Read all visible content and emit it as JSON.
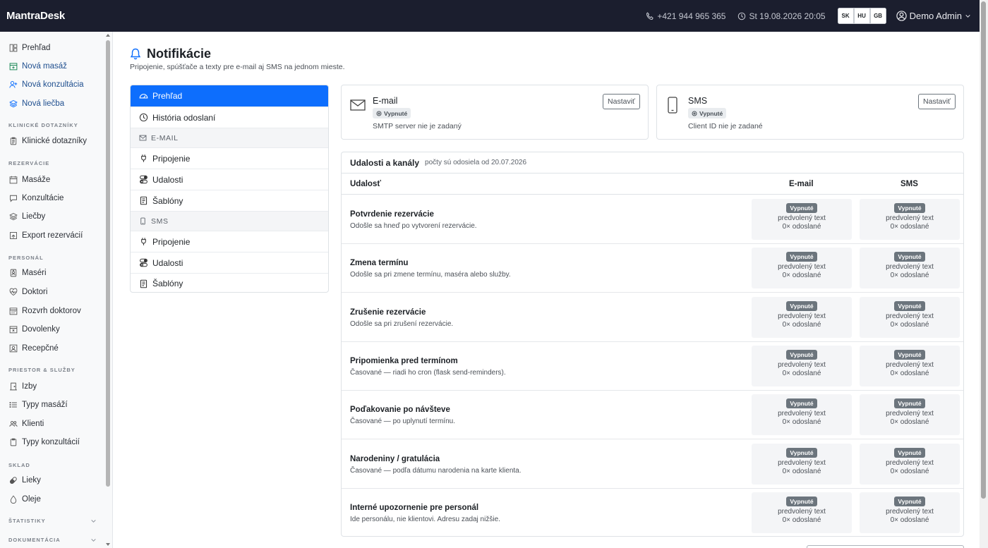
{
  "app": {
    "brand": "MantraDesk"
  },
  "topbar": {
    "phone": "+421 944 965 365",
    "datetime": "St 19.08.2026 20:05",
    "languages": [
      "SK",
      "HU",
      "GB"
    ],
    "user": "Demo Admin"
  },
  "sidebar": {
    "top_items": [
      {
        "label": "Prehľad",
        "icon": "dashboard-icon"
      },
      {
        "label": "Nová masáž",
        "icon": "calendar-plus-icon"
      },
      {
        "label": "Nová konzultácia",
        "icon": "person-plus-icon"
      },
      {
        "label": "Nová liečba",
        "icon": "layers-icon"
      }
    ],
    "sections": [
      {
        "title": "KLINICKÉ DOTAZNÍKY",
        "items": [
          {
            "label": "Klinické dotazníky",
            "icon": "clipboard-icon"
          }
        ]
      },
      {
        "title": "REZERVÁCIE",
        "items": [
          {
            "label": "Masáže",
            "icon": "calendar-icon"
          },
          {
            "label": "Konzultácie",
            "icon": "chat-icon"
          },
          {
            "label": "Liečby",
            "icon": "layers-icon"
          },
          {
            "label": "Export rezervácií",
            "icon": "export-icon"
          }
        ]
      },
      {
        "title": "PERSONÁL",
        "items": [
          {
            "label": "Maséri",
            "icon": "person-badge-icon"
          },
          {
            "label": "Doktori",
            "icon": "heart-pulse-icon"
          },
          {
            "label": "Rozvrh doktorov",
            "icon": "calendar-week-icon"
          },
          {
            "label": "Dovolenky",
            "icon": "calendar-x-icon"
          },
          {
            "label": "Recepčné",
            "icon": "person-square-icon"
          }
        ]
      },
      {
        "title": "PRIESTOR & SLUŽBY",
        "items": [
          {
            "label": "Izby",
            "icon": "door-icon"
          },
          {
            "label": "Typy masáží",
            "icon": "list-icon"
          },
          {
            "label": "Klienti",
            "icon": "people-icon"
          },
          {
            "label": "Typy konzultácií",
            "icon": "clipboard-icon"
          }
        ]
      },
      {
        "title": "SKLAD",
        "items": [
          {
            "label": "Lieky",
            "icon": "capsule-icon"
          },
          {
            "label": "Oleje",
            "icon": "droplet-icon"
          }
        ]
      }
    ],
    "collapsed": [
      "ŠTATISTIKY",
      "DOKUMENTÁCIA"
    ]
  },
  "page": {
    "title": "Notifikácie",
    "subtitle": "Pripojenie, spúšťače a texty pre e-mail aj SMS na jednom mieste."
  },
  "menu": {
    "items": [
      {
        "label": "Prehľad",
        "icon": "speedometer-icon",
        "kind": "active"
      },
      {
        "label": "História odoslaní",
        "icon": "clock-history-icon",
        "kind": "item"
      },
      {
        "label": "E-MAIL",
        "icon": "envelope-icon",
        "kind": "section"
      },
      {
        "label": "Pripojenie",
        "icon": "plug-icon",
        "kind": "item"
      },
      {
        "label": "Udalosti",
        "icon": "toggles-icon",
        "kind": "item"
      },
      {
        "label": "Šablóny",
        "icon": "file-text-icon",
        "kind": "item"
      },
      {
        "label": "SMS",
        "icon": "phone-icon",
        "kind": "section"
      },
      {
        "label": "Pripojenie",
        "icon": "plug-icon",
        "kind": "item"
      },
      {
        "label": "Udalosti",
        "icon": "toggles-icon",
        "kind": "item"
      },
      {
        "label": "Šablóny",
        "icon": "file-text-icon",
        "kind": "item"
      }
    ]
  },
  "channels": {
    "email": {
      "name": "E-mail",
      "status": "Vypnuté",
      "note": "SMTP server nie je zadaný",
      "button": "Nastaviť",
      "icon": "envelope-icon"
    },
    "sms": {
      "name": "SMS",
      "status": "Vypnuté",
      "note": "Client ID nie je zadané",
      "button": "Nastaviť",
      "icon": "phone-icon"
    }
  },
  "events": {
    "title": "Udalosti a kanály",
    "subtitle": "počty sú odosiela od 20.07.2026",
    "columns": [
      "Udalosť",
      "E-mail",
      "SMS"
    ],
    "rows": [
      {
        "title": "Potvrdenie rezervácie",
        "desc": "Odošle sa hneď po vytvorení rezervácie.",
        "email": {
          "status": "Vypnuté",
          "text": "predvolený text",
          "count": "0× odoslané"
        },
        "sms": {
          "status": "Vypnuté",
          "text": "predvolený text",
          "count": "0× odoslané"
        }
      },
      {
        "title": "Zmena termínu",
        "desc": "Odošle sa pri zmene termínu, maséra alebo služby.",
        "email": {
          "status": "Vypnuté",
          "text": "predvolený text",
          "count": "0× odoslané"
        },
        "sms": {
          "status": "Vypnuté",
          "text": "predvolený text",
          "count": "0× odoslané"
        }
      },
      {
        "title": "Zrušenie rezervácie",
        "desc": "Odošle sa pri zrušení rezervácie.",
        "email": {
          "status": "Vypnuté",
          "text": "predvolený text",
          "count": "0× odoslané"
        },
        "sms": {
          "status": "Vypnuté",
          "text": "predvolený text",
          "count": "0× odoslané"
        }
      },
      {
        "title": "Pripomienka pred termínom",
        "desc": "Časované — riadi ho cron (flask send-reminders).",
        "email": {
          "status": "Vypnuté",
          "text": "predvolený text",
          "count": "0× odoslané"
        },
        "sms": {
          "status": "Vypnuté",
          "text": "predvolený text",
          "count": "0× odoslané"
        }
      },
      {
        "title": "Poďakovanie po návšteve",
        "desc": "Časované — po uplynutí termínu.",
        "email": {
          "status": "Vypnuté",
          "text": "predvolený text",
          "count": "0× odoslané"
        },
        "sms": {
          "status": "Vypnuté",
          "text": "predvolený text",
          "count": "0× odoslané"
        }
      },
      {
        "title": "Narodeniny / gratulácia",
        "desc": "Časované — podľa dátumu narodenia na karte klienta.",
        "email": {
          "status": "Vypnuté",
          "text": "predvolený text",
          "count": "0× odoslané"
        },
        "sms": {
          "status": "Vypnuté",
          "text": "predvolený text",
          "count": "0× odoslané"
        }
      },
      {
        "title": "Interné upozornenie pre personál",
        "desc": "Ide personálu, nie klientovi. Adresu zadaj nižšie.",
        "email": {
          "status": "Vypnuté",
          "text": "predvolený text",
          "count": "0× odoslané"
        },
        "sms": {
          "status": "Vypnuté",
          "text": "predvolený text",
          "count": "0× odoslané"
        }
      }
    ]
  }
}
